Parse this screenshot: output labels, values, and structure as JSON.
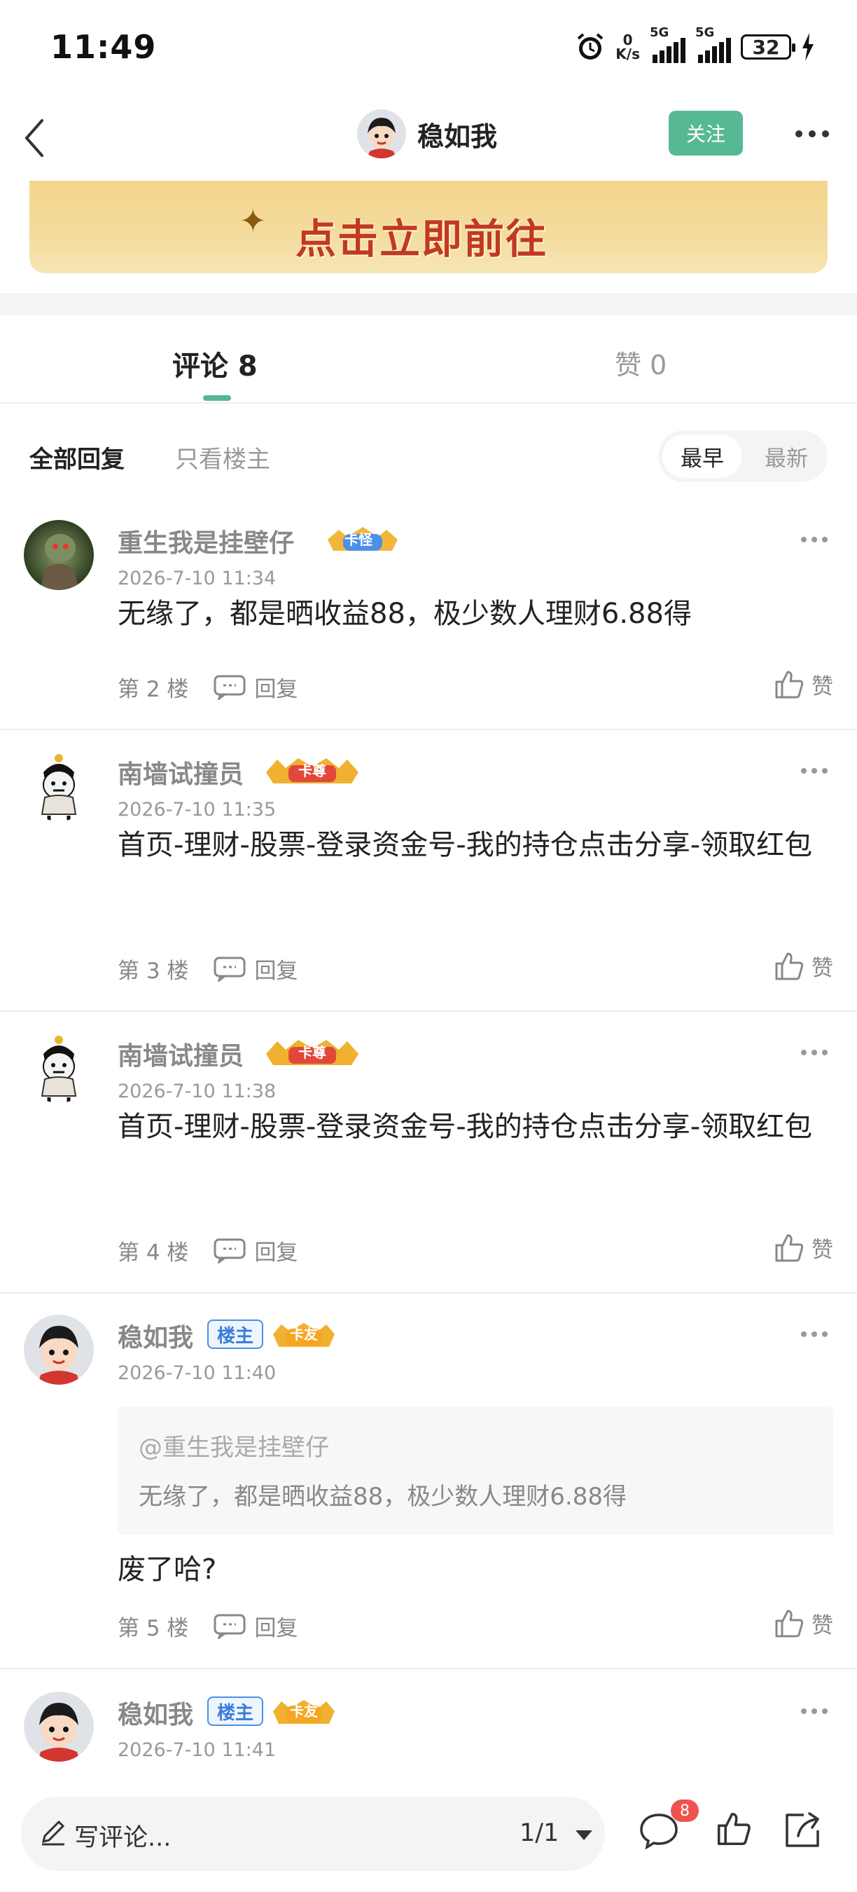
{
  "status_bar": {
    "time": "11:49",
    "net_speed_value": "0",
    "net_speed_unit": "K/s",
    "sim1": "5G",
    "sim2": "5G",
    "battery": "32"
  },
  "header": {
    "author_name": "稳如我",
    "follow_label": "关注"
  },
  "banner": {
    "text": "点击立即前往"
  },
  "tabs": {
    "comments_label": "评论 8",
    "likes_label": "赞 0"
  },
  "filter": {
    "all_label": "全部回复",
    "host_only_label": "只看楼主",
    "sort_earliest": "最早",
    "sort_latest": "最新"
  },
  "comments": [
    {
      "user": "重生我是挂壁仔",
      "badge": "卡怪",
      "time": "2026-7-10 11:34",
      "text": "无缘了，都是晒收益88，极少数人理财6.88得",
      "floor": "第 2 楼",
      "reply": "回复",
      "like": "赞"
    },
    {
      "user": "南墙试撞员",
      "badge": "卡尊",
      "time": "2026-7-10 11:35",
      "text": "首页-理财-股票-登录资金号-我的持仓点击分享-领取红包",
      "floor": "第 3 楼",
      "reply": "回复",
      "like": "赞"
    },
    {
      "user": "南墙试撞员",
      "badge": "卡尊",
      "time": "2026-7-10 11:38",
      "text": "首页-理财-股票-登录资金号-我的持仓点击分享-领取红包",
      "floor": "第 4 楼",
      "reply": "回复",
      "like": "赞"
    },
    {
      "user": "稳如我",
      "host_badge": "楼主",
      "badge": "卡友",
      "time": "2026-7-10 11:40",
      "quote_user": "@重生我是挂壁仔",
      "quote_text": "无缘了，都是晒收益88，极少数人理财6.88得",
      "text": "废了哈?",
      "floor": "第 5 楼",
      "reply": "回复",
      "like": "赞"
    },
    {
      "user": "稳如我",
      "host_badge": "楼主",
      "badge": "卡友",
      "time": "2026-7-10 11:41"
    }
  ],
  "bottom_bar": {
    "placeholder": "写评论...",
    "page": "1/1",
    "comment_count": "8"
  },
  "colors": {
    "accent": "#57b994",
    "badge_red": "#ef5350",
    "host_blue": "#3a7dd6"
  },
  "icons": [
    "back-icon",
    "more-icon",
    "sparkle-icon",
    "reply-icon",
    "thumb-up-icon",
    "pen-icon",
    "comment-icon",
    "share-icon",
    "alarm-icon",
    "charging-icon"
  ]
}
